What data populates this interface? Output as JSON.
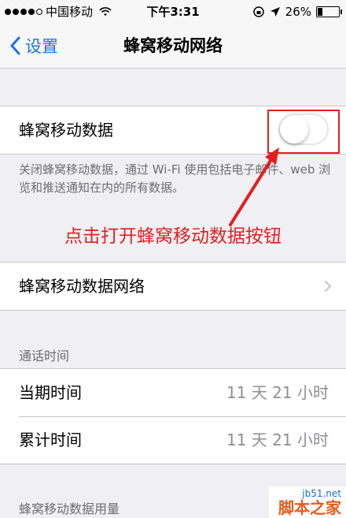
{
  "status_bar": {
    "carrier": "中国移动",
    "time": "下午3:31",
    "battery_percent": "26%",
    "battery_level": 0.26,
    "signal_bars_filled": 4,
    "signal_bars_total": 5
  },
  "nav": {
    "back_label": "设置",
    "title": "蜂窝移动网络"
  },
  "cellular_data": {
    "label": "蜂窝移动数据",
    "enabled": false,
    "footnote": "关闭蜂窝移动数据，通过 Wi-Fi 使用包括电子邮件、web 浏览和推送通知在内的所有数据。"
  },
  "annotation": {
    "text": "点击打开蜂窝移动数据按钮",
    "color": "#e02020"
  },
  "cellular_network": {
    "label": "蜂窝移动数据网络"
  },
  "call_time": {
    "header": "通话时间",
    "rows": [
      {
        "label": "当期时间",
        "value": "11 天 21 小时"
      },
      {
        "label": "累计时间",
        "value": "11 天 21 小时"
      }
    ]
  },
  "usage_section": {
    "header": "蜂窝移动数据用量"
  },
  "watermark": {
    "site": "jb51.net",
    "name": "脚本之家"
  },
  "colors": {
    "accent": "#1a73e8",
    "background": "#efeff4",
    "annotation_red": "#e02020"
  }
}
